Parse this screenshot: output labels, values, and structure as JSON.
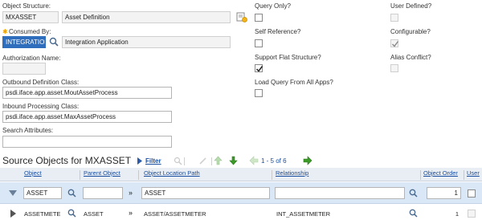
{
  "form": {
    "object_structure_label": "Object Structure:",
    "object_structure_value": "MXASSET",
    "object_structure_desc": "Asset Definition",
    "consumed_by_label": "Consumed By:",
    "consumed_by_value": "INTEGRATION",
    "consumed_by_desc": "Integration Application",
    "authorization_name_label": "Authorization Name:",
    "authorization_name_value": "",
    "outbound_label": "Outbound Definition Class:",
    "outbound_value": "psdi.iface.app.asset.MoutAssetProcess",
    "inbound_label": "Inbound Processing Class:",
    "inbound_value": "psdi.iface.app.asset.MaxAssetProcess",
    "search_attributes_label": "Search Attributes:",
    "search_attributes_value": "",
    "query_only_label": "Query Only?",
    "user_defined_label": "User Defined?",
    "self_reference_label": "Self Reference?",
    "configurable_label": "Configurable?",
    "support_flat_label": "Support Flat Structure?",
    "alias_conflict_label": "Alias Conflict?",
    "load_query_label": "Load Query From All Apps?",
    "query_only": false,
    "user_defined": false,
    "self_reference": false,
    "configurable": true,
    "support_flat": true,
    "alias_conflict": false,
    "load_query": false
  },
  "source_objects": {
    "title": "Source Objects for MXASSET",
    "filter_label": "Filter",
    "pagination": "1 - 5 of 6",
    "columns": [
      "Object",
      "Parent Object",
      "Object Location Path",
      "Relationship",
      "Object Order",
      "User"
    ],
    "filter_row": {
      "object": "ASSET",
      "parent_object": "",
      "location_path": "ASSET",
      "relationship": "",
      "order": "1"
    },
    "rows": [
      {
        "object": "ASSETMETE",
        "parent_object": "ASSET",
        "location_path": "ASSET/ASSETMETER",
        "relationship": "INT_ASSETMETER",
        "order": "1"
      }
    ]
  },
  "colors": {
    "selected_bg": "#2f6ebd",
    "link": "#1a4e9e",
    "required_star": "#f0a000",
    "arrow_green": "#3c9a28"
  }
}
